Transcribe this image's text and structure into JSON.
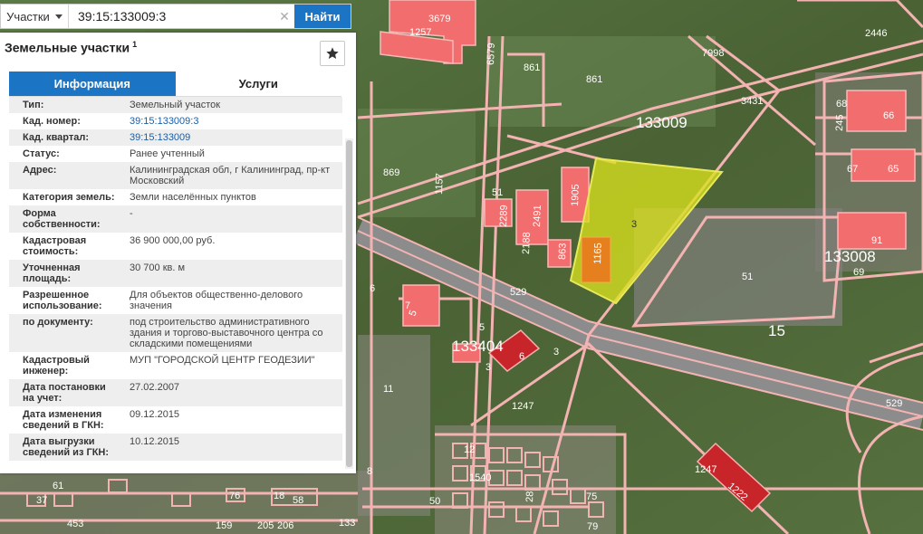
{
  "search": {
    "scope_label": "Участки",
    "query": "39:15:133009:3",
    "clear_symbol": "✕",
    "find_label": "Найти"
  },
  "panel": {
    "title": "Земельные участки",
    "title_sup": "1",
    "favorite_icon": "star-icon",
    "tabs": [
      {
        "label": "Информация",
        "active": true
      },
      {
        "label": "Услуги",
        "active": false
      }
    ],
    "rows": [
      {
        "key": "Тип:",
        "value": "Земельный участок"
      },
      {
        "key": "Кад. номер:",
        "value": "39:15:133009:3",
        "link": true
      },
      {
        "key": "Кад. квартал:",
        "value": "39:15:133009",
        "link": true
      },
      {
        "key": "Статус:",
        "value": "Ранее учтенный"
      },
      {
        "key": "Адрес:",
        "value": "Калининградская обл, г Калининград, пр-кт Московский"
      },
      {
        "key": "Категория земель:",
        "value": "Земли населённых пунктов"
      },
      {
        "key": "Форма собственности:",
        "value": "-"
      },
      {
        "key": "Кадастровая стоимость:",
        "value": "36 900 000,00 руб."
      },
      {
        "key": "Уточненная площадь:",
        "value": "30 700 кв. м"
      },
      {
        "key": "Разрешенное использование:",
        "value": "Для объектов общественно-делового значения"
      },
      {
        "key": "по документу:",
        "value": "под строительство административного здания и торгово-выставочного центра со складскими помещениями"
      },
      {
        "key": "Кадастровый инженер:",
        "value": "МУП \"ГОРОДСКОЙ ЦЕНТР ГЕОДЕЗИИ\""
      },
      {
        "key": "Дата постановки на учет:",
        "value": "27.02.2007"
      },
      {
        "key": "Дата изменения сведений в ГКН:",
        "value": "09.12.2015"
      },
      {
        "key": "Дата выгрузки сведений из ГКН:",
        "value": "10.12.2015"
      }
    ]
  },
  "map": {
    "colors": {
      "satellite": "#4f6a3a",
      "parcel_line": "#f4b3b3",
      "building": "#f26d6d",
      "selected": "#d9e21e"
    },
    "labels": {
      "l3679": "3679",
      "l1257": "1257",
      "l6579": "6579",
      "l861a": "861",
      "l861b": "861",
      "l7998": "7998",
      "l2446": "2446",
      "l3431": "3431",
      "l133009": "133009",
      "l68": "68",
      "l66": "66",
      "l245": "245",
      "l67": "67",
      "l65": "65",
      "l869": "869",
      "l1157": "1157",
      "l51a": "51",
      "l1905": "1905",
      "l2289": "2289",
      "l2491": "2491",
      "l3": "3",
      "l2188": "2188",
      "l863": "863",
      "l1165": "1165",
      "l91": "91",
      "l133008": "133008",
      "l69": "69",
      "l51b": "51",
      "l529a": "529",
      "l6a": "6",
      "l7": "7",
      "l5a": "5",
      "l15": "15",
      "l133404": "133404",
      "l5b": "5",
      "l6b": "6",
      "l3b": "3",
      "l3c": "3",
      "l11": "11",
      "l1247a": "1247",
      "l529b": "529",
      "l1247b": "1247",
      "l1222": "1222",
      "l8": "8",
      "l1540": "1540",
      "l50": "50",
      "l37": "37",
      "l61": "61",
      "l76": "76",
      "l18": "18",
      "l58": "58",
      "l75": "75",
      "l79": "79",
      "l453": "453",
      "l159": "159",
      "l205": "205",
      "l206": "206",
      "l133": "133",
      "l12": "12",
      "l28": "28"
    }
  }
}
